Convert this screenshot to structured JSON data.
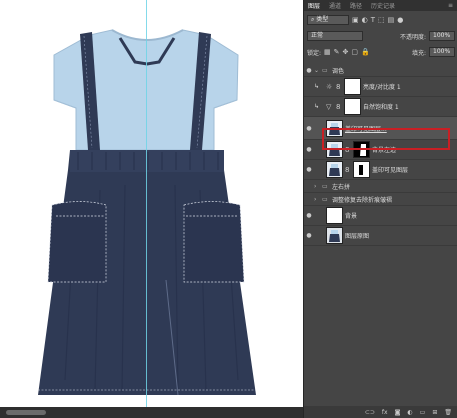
{
  "panel": {
    "tabs": [
      "图层",
      "通道",
      "路径",
      "历史记录"
    ],
    "filter_label": "类型",
    "blend_mode": "正常",
    "opacity_label": "不透明度:",
    "opacity_value": "100%",
    "lock_label": "锁定:",
    "fill_label": "填充:",
    "fill_value": "100%"
  },
  "layers": [
    {
      "name": "调色",
      "type": "group",
      "visible": true
    },
    {
      "name": "亮度/对比度 1",
      "type": "adjustment",
      "visible": false
    },
    {
      "name": "自然饱和度 1",
      "type": "adjustment",
      "visible": false
    },
    {
      "name": "盖印可见图层...",
      "type": "pixel",
      "visible": true,
      "selected": true
    },
    {
      "name": "背景左边",
      "type": "masked",
      "visible": true
    },
    {
      "name": "盖印可见图层",
      "type": "masked",
      "visible": true
    },
    {
      "name": "左右拼",
      "type": "group",
      "visible": false
    },
    {
      "name": "调整修复去除折痕皱褶",
      "type": "group",
      "visible": false
    },
    {
      "name": "背景",
      "type": "pixel",
      "visible": true
    },
    {
      "name": "图层原图",
      "type": "pixel",
      "visible": true
    }
  ],
  "bottom_icons": [
    "link-icon",
    "fx-icon",
    "mask-icon",
    "adjustment-icon",
    "folder-icon",
    "new-layer-icon",
    "trash-icon"
  ],
  "colors": {
    "shirt": "#b8d4ea",
    "skirt": "#2f3a55",
    "highlight": "#c91f24",
    "guide": "#6fd4e6"
  }
}
